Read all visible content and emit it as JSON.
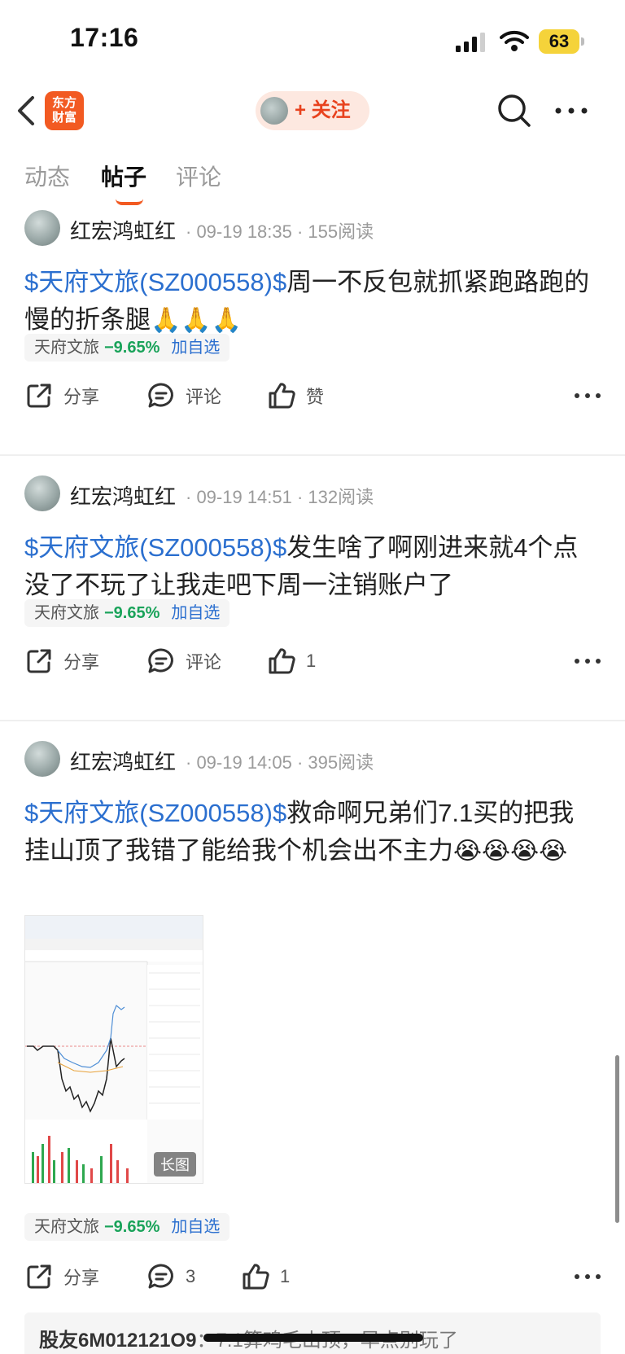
{
  "status_bar": {
    "time": "17:16",
    "battery": "63"
  },
  "nav": {
    "logo_text": "东方财富",
    "follow_label": "+ 关注"
  },
  "tabs": [
    {
      "label": "动态",
      "active": false
    },
    {
      "label": "帖子",
      "active": true
    },
    {
      "label": "评论",
      "active": false
    }
  ],
  "posts": [
    {
      "author": "红宏鸿虹红",
      "meta": "· 09-19 18:35 · 155阅读",
      "stock_tag": "$天府文旅(SZ000558)$",
      "text": "周一不反包就抓紧跑路跑的慢的折条腿",
      "emoji": "🙏🙏🙏",
      "chip": {
        "name": "天府文旅",
        "change": "−9.65%",
        "add": "加自选"
      },
      "actions": {
        "share": "分享",
        "comment": "评论",
        "like": "赞"
      }
    },
    {
      "author": "红宏鸿虹红",
      "meta": "· 09-19 14:51 · 132阅读",
      "stock_tag": "$天府文旅(SZ000558)$",
      "text": "发生啥了啊刚进来就4个点没了不玩了让我走吧下周一注销账户了",
      "emoji": "",
      "chip": {
        "name": "天府文旅",
        "change": "−9.65%",
        "add": "加自选"
      },
      "actions": {
        "share": "分享",
        "comment": "评论",
        "like": "1"
      }
    },
    {
      "author": "红宏鸿虹红",
      "meta": "· 09-19 14:05 · 395阅读",
      "stock_tag": "$天府文旅(SZ000558)$",
      "text": "救命啊兄弟们7.1买的把我挂山顶了我错了能给我个机会出不主力",
      "emoji": "😭😭😭😭",
      "image_label": "长图",
      "chip": {
        "name": "天府文旅",
        "change": "−9.65%",
        "add": "加自选"
      },
      "actions": {
        "share": "分享",
        "comment": "3",
        "like": "1"
      }
    }
  ],
  "comment_preview": {
    "user": "股友6M012121O9",
    "text": "：7.1算鸡毛山顶，早点别玩了"
  },
  "colors": {
    "accent": "#f25a22",
    "link": "#2b6fcf",
    "down": "#1aa35a"
  }
}
